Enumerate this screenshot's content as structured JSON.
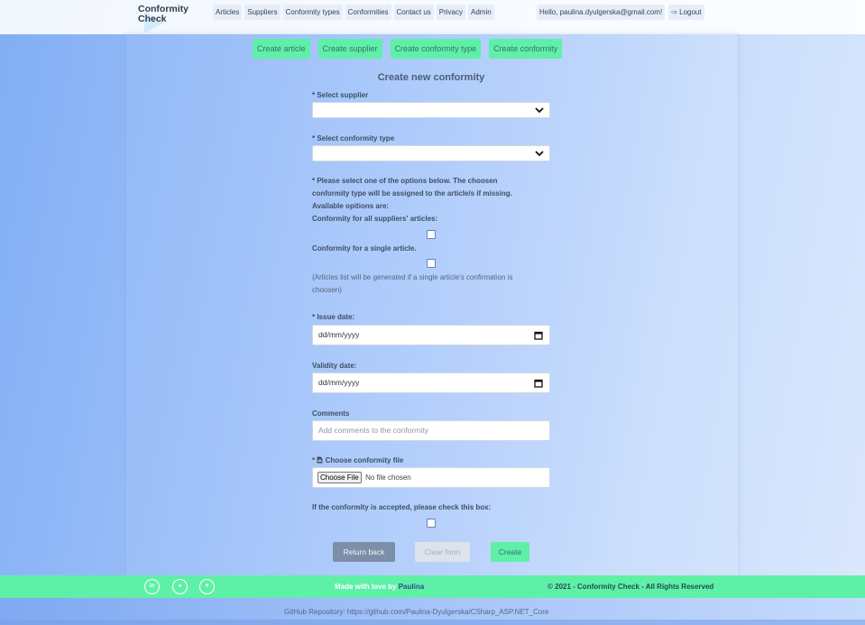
{
  "brand": {
    "line1": "Conformity",
    "line2": "Check"
  },
  "nav": {
    "items": [
      "Articles",
      "Suppliers",
      "Conformity types",
      "Conformities",
      "Contact us",
      "Privacy",
      "Admin"
    ],
    "user_greeting": "Hello, paulina.dyulgerska@gmail.com!",
    "logout_label": "Logout"
  },
  "actions": [
    "Create article",
    "Create supplier",
    "Create conformity type",
    "Create conformity"
  ],
  "form": {
    "title": "Create new conformity",
    "supplier_label": "* Select supplier",
    "supplier_value": "",
    "type_label": "* Select conformity type",
    "type_value": "",
    "options_text_1": "* Please select one of the options below. The choosen",
    "options_text_2": "conformity type will be assigned to the article/s if missing.",
    "options_text_3": "Available opitions are:",
    "option_all_label": "Conformity for all suppliers' articles:",
    "option_single_label": "Conformity for a single article.",
    "option_note_1": "(Articles list will be generated if a single article's confirmation is",
    "option_note_2": "choosen)",
    "issue_label": "* Issue date:",
    "issue_value": "dd/mm/yyyy",
    "validity_label": "Validity date:",
    "validity_value": "dd/mm/yyyy",
    "comments_label": "Comments",
    "comments_placeholder": "Add comments to the conformity",
    "file_label_prefix": "*",
    "file_label": "Choose conformity file",
    "file_button": "Choose File",
    "file_status": "No file chosen",
    "accepted_label": "If the conformity is accepted, please check this box:",
    "checkbox_all_checked": false,
    "checkbox_single_checked": false,
    "checkbox_accepted_checked": false
  },
  "buttons": {
    "back": "Return back",
    "clear": "Clear form",
    "create": "Create"
  },
  "footer": {
    "social": [
      "linkedin-icon",
      "github-icon",
      "twitter-icon"
    ],
    "made_prefix": "Made with love by",
    "made_author": "Paulina",
    "copyright": "© 2021 - Conformity Check - All Rights Reserved",
    "github": "GitHub Repository: https://github.com/Paulina-Dyulgerska/CSharp_ASP.NET_Core"
  },
  "colors": {
    "accent_green": "#5ff0a8",
    "background_blue": "#a9c8fb",
    "back_button": "#7d8fa8"
  }
}
